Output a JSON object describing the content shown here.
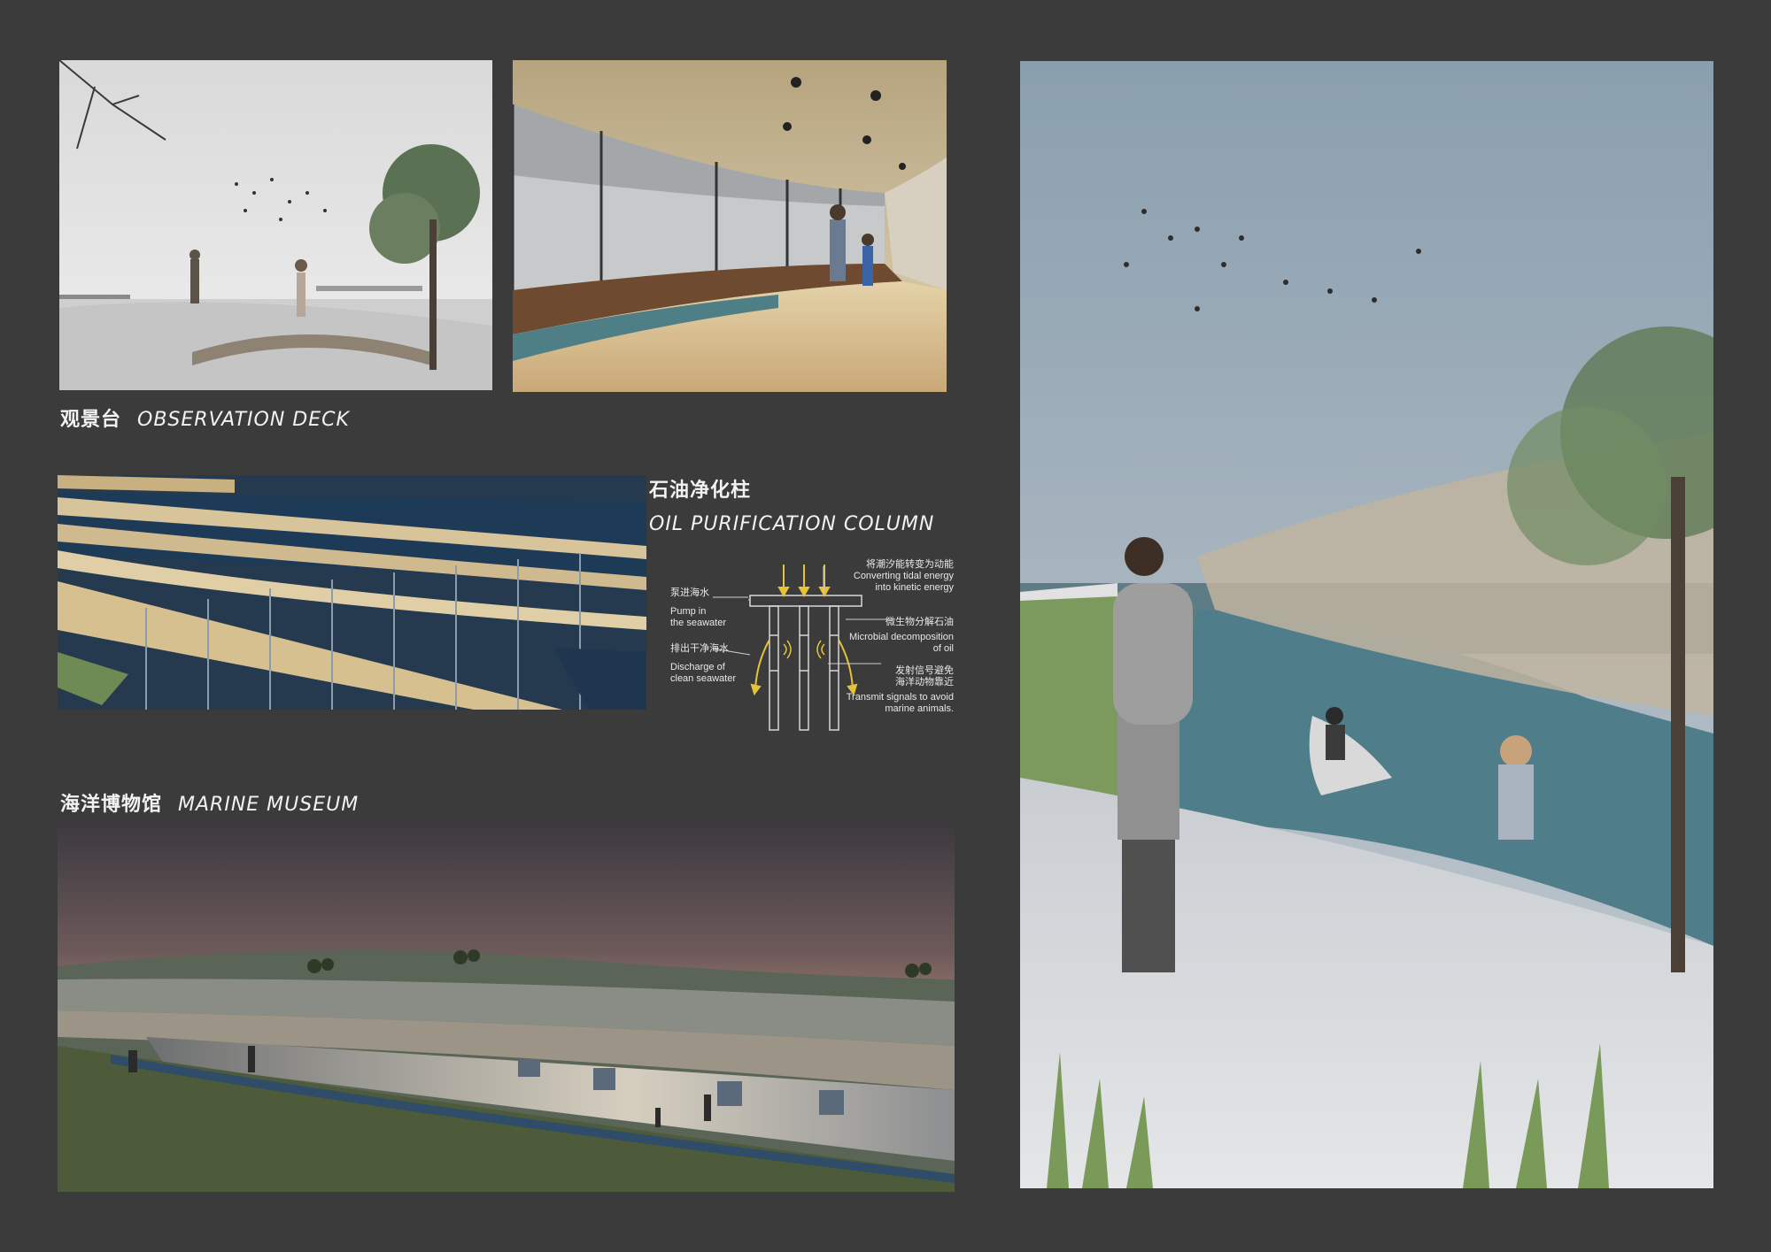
{
  "observation_deck": {
    "title_zh": "观景台",
    "title_en": "OBSERVATION DECK"
  },
  "oil_column": {
    "title_zh": "石油净化柱",
    "title_en": "OIL PURIFICATION COLUMN",
    "labels": {
      "pump_zh": "泵进海水",
      "pump_en_1": "Pump in",
      "pump_en_2": "the seawater",
      "discharge_zh": "排出干净海水",
      "discharge_en_1": "Discharge of",
      "discharge_en_2": "clean seawater",
      "tidal_zh": "将潮汐能转变为动能",
      "tidal_en_1": "Converting tidal energy",
      "tidal_en_2": "into kinetic energy",
      "microbial_zh": "微生物分解石油",
      "microbial_en_1": "Microbial decomposition",
      "microbial_en_2": "of oil",
      "signal_zh_1": "发射信号避免",
      "signal_zh_2": "海洋动物靠近",
      "signal_en_1": "Transmit signals to avoid",
      "signal_en_2": "marine animals."
    }
  },
  "marine_museum": {
    "title_zh": "海洋博物馆",
    "title_en": "MARINE MUSEUM"
  },
  "colors": {
    "background": "#3b3b3c",
    "text": "#f2f2f2",
    "diagram_line": "#d8d8d8",
    "accent_yellow": "#e6c23a"
  }
}
